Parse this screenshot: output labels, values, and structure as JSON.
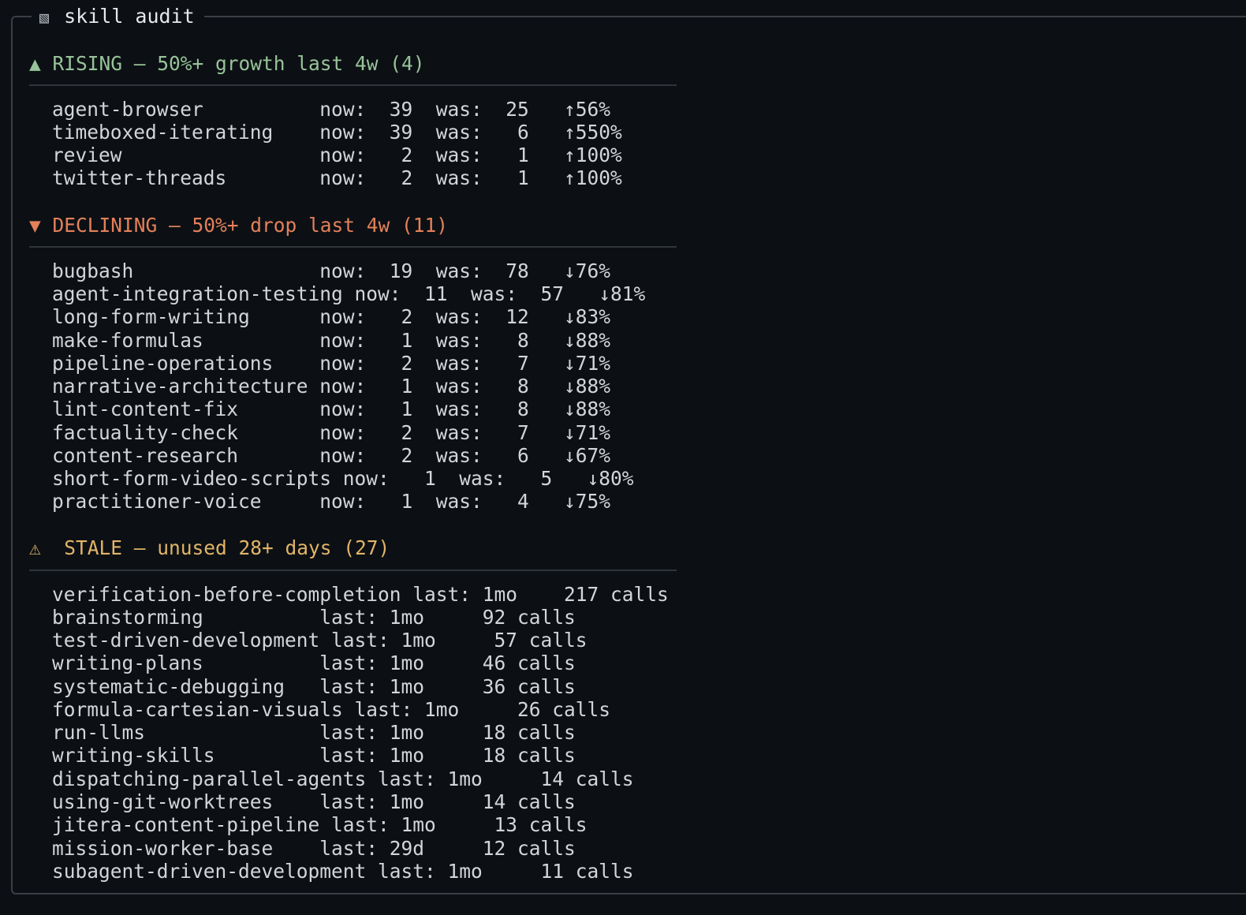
{
  "panel": {
    "icon": "▧",
    "title": "skill audit"
  },
  "sections": {
    "rising": {
      "icon": "▲",
      "header": "RISING — 50%+ growth last 4w (4)",
      "color": "#98c39a",
      "rows": [
        "agent-browser          now:  39  was:  25   ↑56%",
        "timeboxed-iterating    now:  39  was:   6   ↑550%",
        "review                 now:   2  was:   1   ↑100%",
        "twitter-threads        now:   2  was:   1   ↑100%"
      ]
    },
    "declining": {
      "icon": "▼",
      "header": "DECLINING — 50%+ drop last 4w (11)",
      "color": "#e4805a",
      "rows": [
        "bugbash                now:  19  was:  78   ↓76%",
        "agent-integration-testing now:  11  was:  57   ↓81%",
        "long-form-writing      now:   2  was:  12   ↓83%",
        "make-formulas          now:   1  was:   8   ↓88%",
        "pipeline-operations    now:   2  was:   7   ↓71%",
        "narrative-architecture now:   1  was:   8   ↓88%",
        "lint-content-fix       now:   1  was:   8   ↓88%",
        "factuality-check       now:   2  was:   7   ↓71%",
        "content-research       now:   2  was:   6   ↓67%",
        "short-form-video-scripts now:   1  was:   5   ↓80%",
        "practitioner-voice     now:   1  was:   4   ↓75%"
      ]
    },
    "stale": {
      "icon": "⚠",
      "header": "STALE — unused 28+ days (27)",
      "color": "#e2b469",
      "rows": [
        "verification-before-completion last: 1mo    217 calls",
        "brainstorming          last: 1mo     92 calls",
        "test-driven-development last: 1mo     57 calls",
        "writing-plans          last: 1mo     46 calls",
        "systematic-debugging   last: 1mo     36 calls",
        "formula-cartesian-visuals last: 1mo     26 calls",
        "run-llms               last: 1mo     18 calls",
        "writing-skills         last: 1mo     18 calls",
        "dispatching-parallel-agents last: 1mo     14 calls",
        "using-git-worktrees    last: 1mo     14 calls",
        "jitera-content-pipeline last: 1mo     13 calls",
        "mission-worker-base    last: 29d     12 calls",
        "subagent-driven-development last: 1mo     11 calls"
      ]
    }
  }
}
